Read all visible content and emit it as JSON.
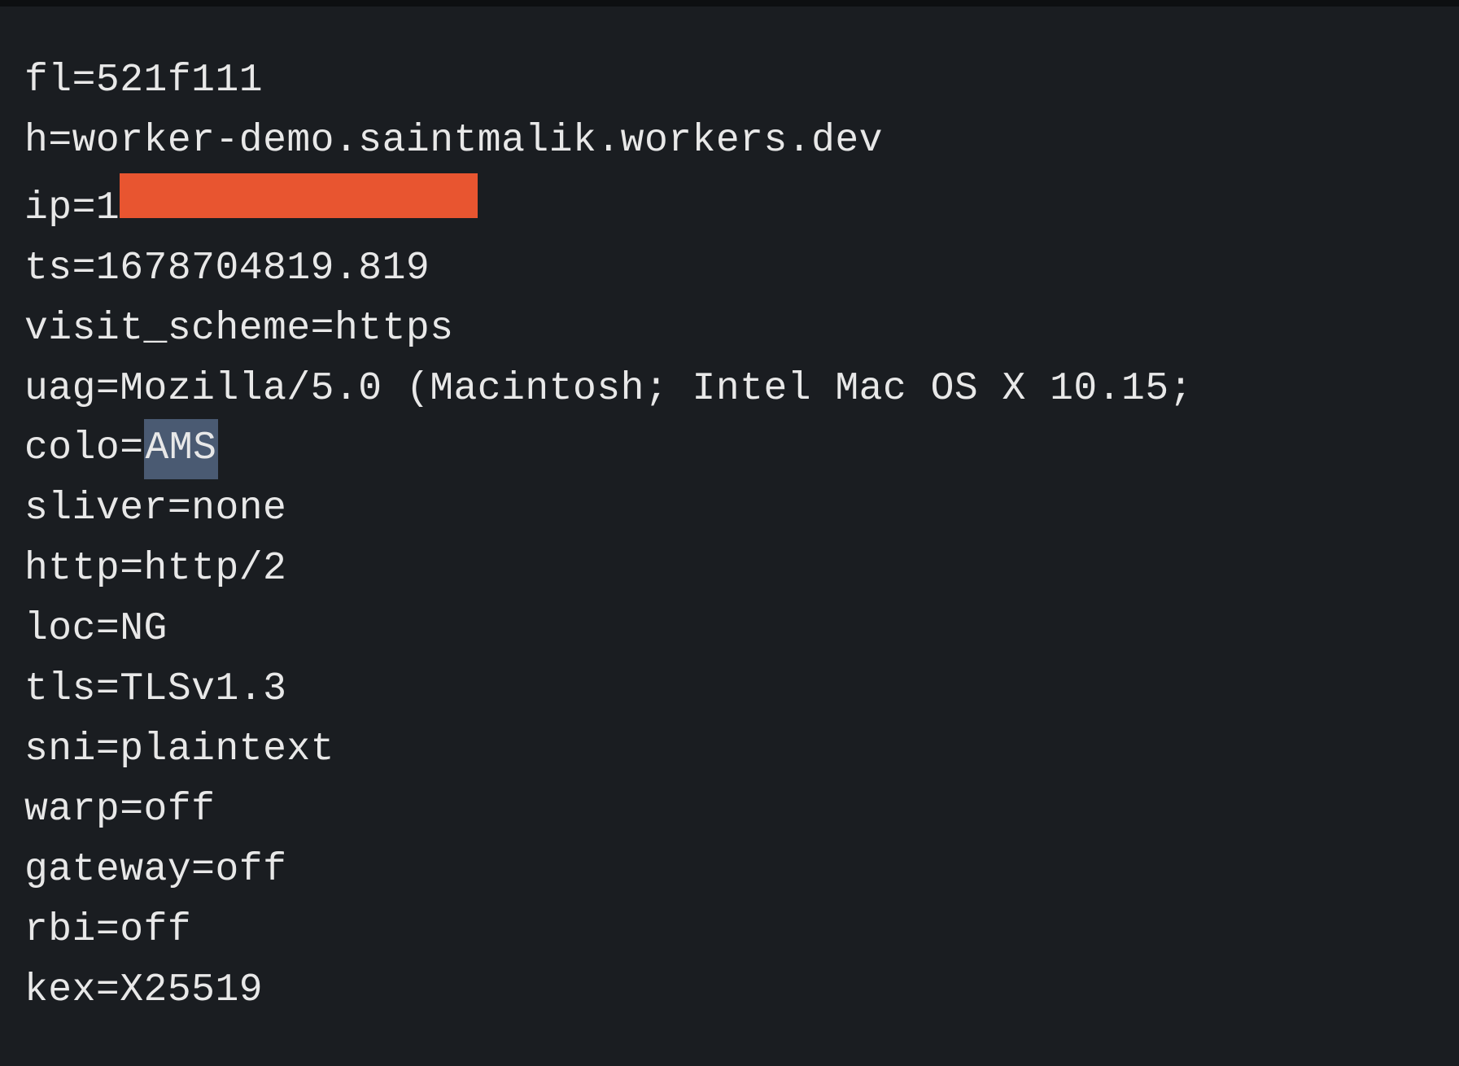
{
  "lines": {
    "fl": {
      "key": "fl",
      "value": "521f111"
    },
    "h": {
      "key": "h",
      "value": "worker-demo.saintmalik.workers.dev"
    },
    "ip": {
      "key": "ip",
      "prefix": "1"
    },
    "ts": {
      "key": "ts",
      "value": "1678704819.819"
    },
    "visit_scheme": {
      "key": "visit_scheme",
      "value": "https"
    },
    "uag": {
      "key": "uag",
      "value": "Mozilla/5.0 (Macintosh; Intel Mac OS X 10.15;"
    },
    "colo": {
      "key": "colo",
      "value": "AMS"
    },
    "sliver": {
      "key": "sliver",
      "value": "none"
    },
    "http": {
      "key": "http",
      "value": "http/2"
    },
    "loc": {
      "key": "loc",
      "value": "NG"
    },
    "tls": {
      "key": "tls",
      "value": "TLSv1.3"
    },
    "sni": {
      "key": "sni",
      "value": "plaintext"
    },
    "warp": {
      "key": "warp",
      "value": "off"
    },
    "gateway": {
      "key": "gateway",
      "value": "off"
    },
    "rbi": {
      "key": "rbi",
      "value": "off"
    },
    "kex": {
      "key": "kex",
      "value": "X25519"
    }
  }
}
